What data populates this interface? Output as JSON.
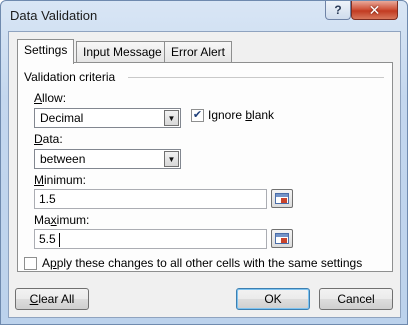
{
  "window": {
    "title": "Data Validation",
    "help_label": "?",
    "close_label": "✕"
  },
  "tabs": [
    {
      "label": "Settings",
      "active": true
    },
    {
      "label": "Input Message",
      "active": false
    },
    {
      "label": "Error Alert",
      "active": false
    }
  ],
  "settings": {
    "section_title": "Validation criteria",
    "allow": {
      "label_u": "A",
      "label_rest": "llow:",
      "value": "Decimal"
    },
    "ignore_blank": {
      "label_pre": "Ignore ",
      "label_u": "b",
      "label_rest": "lank",
      "checked": true
    },
    "data": {
      "label_u": "D",
      "label_rest": "ata:",
      "value": "between"
    },
    "minimum": {
      "label_u": "M",
      "label_rest": "inimum:",
      "value": "1.5"
    },
    "maximum": {
      "label_pre": "Ma",
      "label_u": "x",
      "label_rest": "imum:",
      "value": "5.5"
    },
    "apply_all": {
      "label_pre": "A",
      "label_u": "p",
      "label_rest": "ply these changes to all other cells with the same settings",
      "checked": false
    }
  },
  "buttons": {
    "clear_all_u": "C",
    "clear_all_rest": "lear All",
    "ok": "OK",
    "cancel": "Cancel"
  },
  "icons": {
    "dropdown": "▼",
    "check": "✔"
  }
}
